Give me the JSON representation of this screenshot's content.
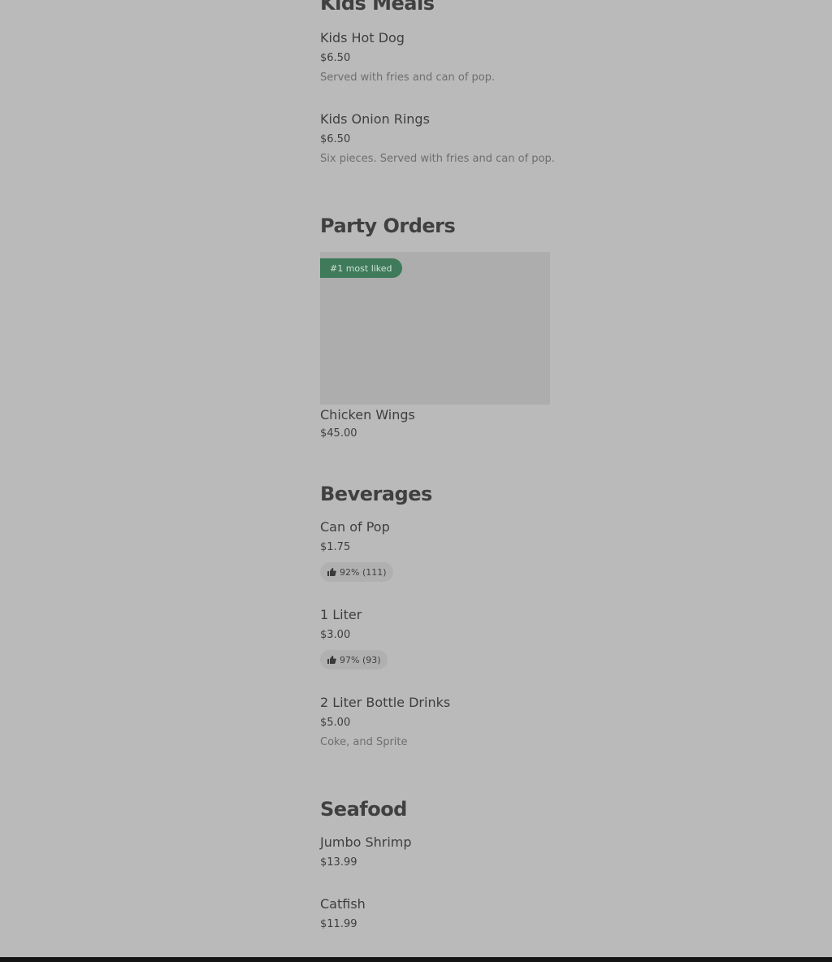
{
  "sections": {
    "kids": {
      "title": "Kids Meals",
      "items": [
        {
          "name": "Kids Hot Dog",
          "price": "$6.50",
          "desc": "Served with fries and can of pop."
        },
        {
          "name": "Kids Onion Rings",
          "price": "$6.50",
          "desc": "Six pieces. Served with fries and can of pop."
        }
      ]
    },
    "party": {
      "title": "Party Orders",
      "card": {
        "badge": "#1 most liked",
        "name": "Chicken Wings",
        "price": "$45.00"
      }
    },
    "beverages": {
      "title": "Beverages",
      "items": [
        {
          "name": "Can of Pop",
          "price": "$1.75",
          "rating": "92% (111)"
        },
        {
          "name": "1 Liter",
          "price": "$3.00",
          "rating": "97% (93)"
        },
        {
          "name": "2 Liter Bottle Drinks",
          "price": "$5.00",
          "desc": "Coke, and Sprite"
        }
      ]
    },
    "seafood": {
      "title": "Seafood",
      "items": [
        {
          "name": "Jumbo Shrimp",
          "price": "$13.99"
        },
        {
          "name": "Catfish",
          "price": "$11.99"
        }
      ]
    }
  },
  "icons": {
    "rating": "thumbs-up-icon"
  },
  "colors": {
    "background": "#bababa",
    "badge": "#3f7a5a",
    "pill": "#b0b0b0"
  }
}
